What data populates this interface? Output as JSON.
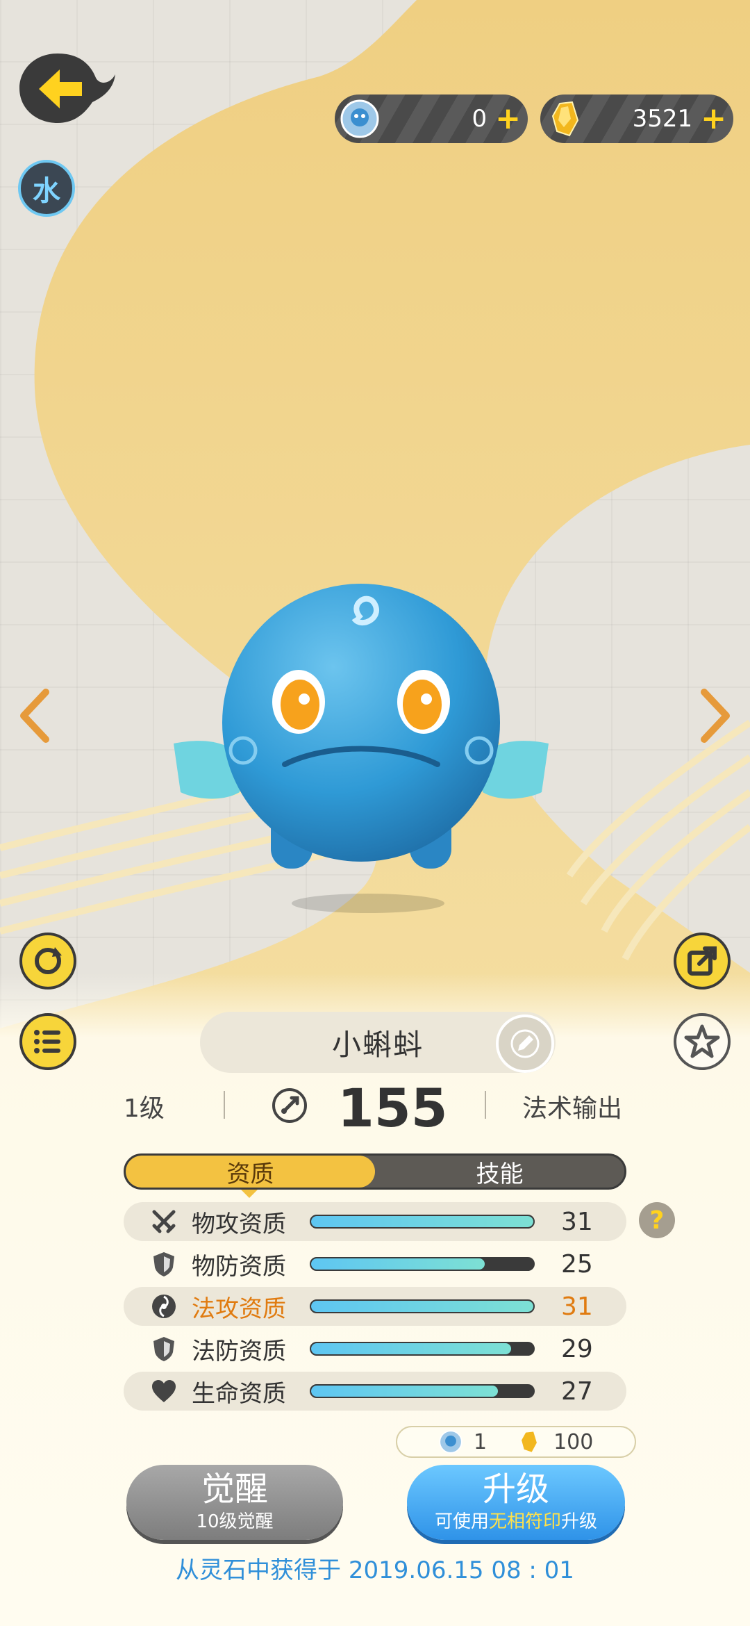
{
  "header": {
    "element_badge": "水",
    "currencies": [
      {
        "icon": "spirit-stone-icon",
        "amount": "0"
      },
      {
        "icon": "gold-crystal-icon",
        "amount": "3521"
      }
    ]
  },
  "pet": {
    "name": "小蝌蚪",
    "level": "1级",
    "power": "155",
    "role": "法术输出"
  },
  "tabs": [
    {
      "label": "资质",
      "active": true
    },
    {
      "label": "技能",
      "active": false
    }
  ],
  "aptitudes": [
    {
      "label": "物攻资质",
      "value": "31",
      "fill": 1.0,
      "icon": "swords-icon",
      "highlight": false,
      "shaded": true
    },
    {
      "label": "物防资质",
      "value": "25",
      "fill": 0.78,
      "icon": "shield-icon",
      "highlight": false,
      "shaded": false
    },
    {
      "label": "法攻资质",
      "value": "31",
      "fill": 1.0,
      "icon": "magic-swirl-icon",
      "highlight": true,
      "shaded": true
    },
    {
      "label": "法防资质",
      "value": "29",
      "fill": 0.9,
      "icon": "magic-shield-icon",
      "highlight": false,
      "shaded": false
    },
    {
      "label": "生命资质",
      "value": "27",
      "fill": 0.84,
      "icon": "heart-icon",
      "highlight": false,
      "shaded": true
    }
  ],
  "cost": {
    "stone_amount": "1",
    "crystal_amount": "100"
  },
  "buttons": {
    "awaken": {
      "label": "觉醒",
      "sub": "10级觉醒"
    },
    "upgrade": {
      "label": "升级",
      "sub_pre": "可使用",
      "sub_highlight": "无相符印",
      "sub_post": "升级"
    }
  },
  "help_label": "?",
  "obtained_text": "从灵石中获得于 2019.06.15   08 : 01",
  "colors": {
    "accent_yellow": "#f3c241",
    "highlight_orange": "#e07b10",
    "upgrade_blue": "#2f93e8",
    "obtained_blue": "#2f8fd9"
  }
}
